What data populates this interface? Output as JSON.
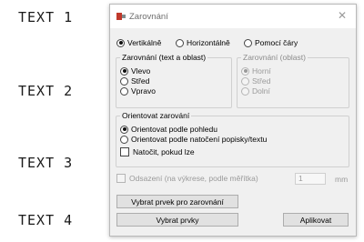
{
  "background_labels": [
    "TEXT 1",
    "TEXT 2",
    "TEXT 3",
    "TEXT 4"
  ],
  "dialog": {
    "title": "Zarovnání",
    "close_glyph": "✕",
    "mode_options": [
      {
        "label": "Vertikálně",
        "selected": true
      },
      {
        "label": "Horizontálně",
        "selected": false
      },
      {
        "label": "Pomocí čáry",
        "selected": false
      }
    ],
    "text_group": {
      "legend": "Zarovnání (text a oblast)",
      "options": [
        {
          "label": "Vlevo",
          "selected": true
        },
        {
          "label": "Střed",
          "selected": false
        },
        {
          "label": "Vpravo",
          "selected": false
        }
      ]
    },
    "area_group": {
      "legend": "Zarovnání (oblast)",
      "disabled": true,
      "options": [
        {
          "label": "Horní",
          "selected": true
        },
        {
          "label": "Střed",
          "selected": false
        },
        {
          "label": "Dolní",
          "selected": false
        }
      ]
    },
    "orient_group": {
      "legend": "Orientovat zarování",
      "options": [
        {
          "label": "Orientovat podle pohledu",
          "selected": true
        },
        {
          "label": "Orientovat podle natočení popisky/textu",
          "selected": false
        }
      ],
      "rotate_checkbox": {
        "label": "Natočit, pokud lze",
        "checked": false
      }
    },
    "offset": {
      "label": "Odsazení (na výkrese, podle měřítka)",
      "value": "1",
      "unit": "mm",
      "checked": false,
      "disabled": true
    },
    "buttons": {
      "select_element": "Vybrat prvek pro zarovnání",
      "select_elements": "Vybrat prvky",
      "apply": "Aplikovat"
    }
  }
}
